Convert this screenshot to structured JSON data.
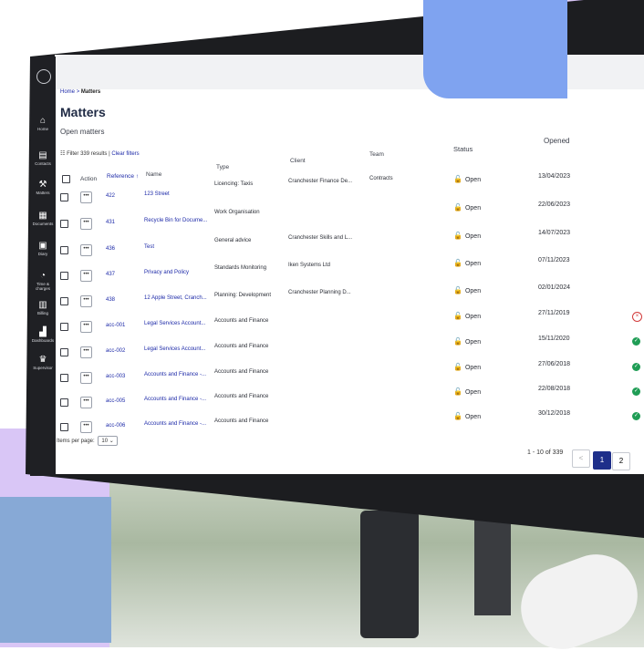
{
  "app": {
    "breadcrumb": {
      "home": "Home",
      "sep": ">",
      "current": "Matters"
    },
    "title": "Matters",
    "subtitle": "Open matters"
  },
  "sidebar": {
    "items": [
      {
        "label": "Home",
        "icon": "home-icon"
      },
      {
        "label": "Contacts",
        "icon": "contacts-icon"
      },
      {
        "label": "Matters",
        "icon": "gavel-icon"
      },
      {
        "label": "Documents",
        "icon": "document-icon"
      },
      {
        "label": "Diary",
        "icon": "calendar-icon"
      },
      {
        "label": "Time & charges",
        "icon": "clock-icon"
      },
      {
        "label": "Billing",
        "icon": "billing-icon"
      },
      {
        "label": "Dashboards",
        "icon": "chart-icon"
      },
      {
        "label": "Supervisor",
        "icon": "crown-icon"
      }
    ]
  },
  "filter": {
    "label": "Filter",
    "results": "339 results",
    "sep": "|",
    "clear": "Clear filters"
  },
  "columns": {
    "action": "Action",
    "reference": "Reference",
    "sort": "↑",
    "name": "Name",
    "type": "Type",
    "client": "Client",
    "team": "Team",
    "status": "Status",
    "opened": "Opened"
  },
  "rows": [
    {
      "reference": "422",
      "name": "123 Street",
      "type": "Licencing: Taxis",
      "client": "Cranchester Finance De...",
      "team": "Contracts",
      "status": "Open",
      "opened": "13/04/2023",
      "mark": ""
    },
    {
      "reference": "431",
      "name": "Recycle Bin for Docume...",
      "type": "Work Organisation",
      "client": "",
      "team": "",
      "status": "Open",
      "opened": "22/06/2023",
      "mark": ""
    },
    {
      "reference": "436",
      "name": "Test",
      "type": "General advice",
      "client": "Cranchester Skills and L...",
      "team": "",
      "status": "Open",
      "opened": "14/07/2023",
      "mark": ""
    },
    {
      "reference": "437",
      "name": "Privacy and Policy",
      "type": "Standards Monitoring",
      "client": "Iken Systems Ltd",
      "team": "",
      "status": "Open",
      "opened": "07/11/2023",
      "mark": ""
    },
    {
      "reference": "438",
      "name": "12 Apple Street, Cranch...",
      "type": "Planning: Development",
      "client": "Cranchester Planning D...",
      "team": "",
      "status": "Open",
      "opened": "02/01/2024",
      "mark": ""
    },
    {
      "reference": "acc-001",
      "name": "Legal Services Account...",
      "type": "Accounts and Finance",
      "client": "",
      "team": "",
      "status": "Open",
      "opened": "27/11/2019",
      "mark": "cross"
    },
    {
      "reference": "acc-002",
      "name": "Legal Services Account...",
      "type": "Accounts and Finance",
      "client": "",
      "team": "",
      "status": "Open",
      "opened": "15/11/2020",
      "mark": "check"
    },
    {
      "reference": "acc-003",
      "name": "Accounts and Finance -...",
      "type": "Accounts and Finance",
      "client": "",
      "team": "",
      "status": "Open",
      "opened": "27/06/2018",
      "mark": "check"
    },
    {
      "reference": "acc-005",
      "name": "Accounts and Finance -...",
      "type": "Accounts and Finance",
      "client": "",
      "team": "",
      "status": "Open",
      "opened": "22/08/2018",
      "mark": "check"
    },
    {
      "reference": "acc-006",
      "name": "Accounts and Finance -...",
      "type": "Accounts and Finance",
      "client": "",
      "team": "",
      "status": "Open",
      "opened": "30/12/2018",
      "mark": "check"
    }
  ],
  "footer": {
    "items_per_page_label": "Items per page:",
    "items_per_page_value": "10",
    "range": "1 - 10 of 339",
    "prev": "<",
    "page1": "1",
    "page2": "2"
  }
}
